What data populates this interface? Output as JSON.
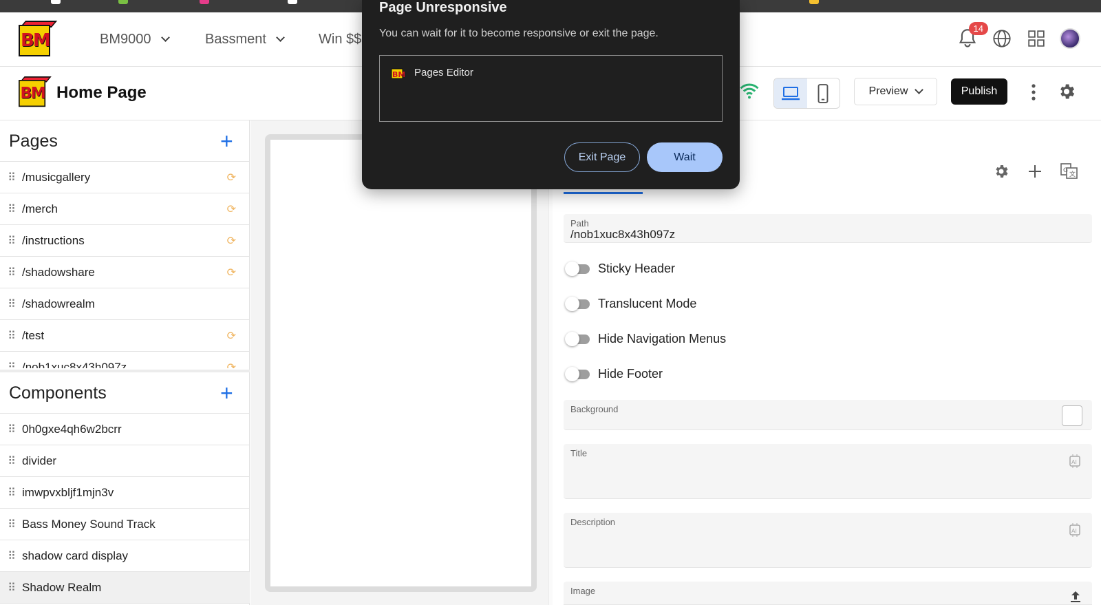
{
  "top_nav": {
    "menus": [
      {
        "label": "BM9000"
      },
      {
        "label": "Bassment"
      },
      {
        "label": "Win $$"
      }
    ],
    "notification_count": "14"
  },
  "page_header": {
    "title": "Home Page",
    "preview_label": "Preview",
    "publish_label": "Publish"
  },
  "sidebar": {
    "pages_title": "Pages",
    "pages": [
      {
        "label": "/musicgallery",
        "synced": true
      },
      {
        "label": "/merch",
        "synced": true
      },
      {
        "label": "/instructions",
        "synced": true
      },
      {
        "label": "/shadowshare",
        "synced": true
      },
      {
        "label": "/shadowrealm",
        "synced": false
      },
      {
        "label": "/test",
        "synced": true
      },
      {
        "label": "/nob1xuc8x43h097z",
        "synced": true
      }
    ],
    "components_title": "Components",
    "components": [
      {
        "label": "0h0gxe4qh6w2bcrr"
      },
      {
        "label": "divider"
      },
      {
        "label": "imwpvxbljf1mjn3v"
      },
      {
        "label": "Bass Money Sound Track"
      },
      {
        "label": "shadow card display"
      },
      {
        "label": "Shadow Realm"
      }
    ]
  },
  "settings_panel": {
    "path_label": "Path",
    "path_value": "/nob1xuc8x43h097z",
    "toggles": [
      {
        "label": "Sticky Header",
        "on": false
      },
      {
        "label": "Translucent Mode",
        "on": false
      },
      {
        "label": "Hide Navigation Menus",
        "on": false
      },
      {
        "label": "Hide Footer",
        "on": false
      }
    ],
    "background_label": "Background",
    "title_label": "Title",
    "description_label": "Description",
    "image_label": "Image"
  },
  "dialog": {
    "title": "Page Unresponsive",
    "message": "You can wait for it to become responsive or exit the page.",
    "page_name": "Pages Editor",
    "exit_label": "Exit Page",
    "wait_label": "Wait"
  },
  "colors": {
    "accent": "#1f6fe5",
    "dialog_bg": "#1f1f1f",
    "wait_button": "#a8c7fa",
    "badge": "#e54848",
    "sync_icon": "#f0b560"
  }
}
